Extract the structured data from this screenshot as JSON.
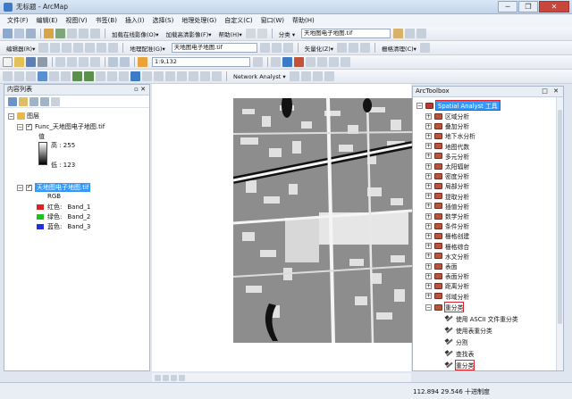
{
  "window": {
    "title": "无标题 - ArcMap",
    "controls": [
      "─",
      "❐",
      "✕"
    ]
  },
  "menu": [
    "文件(F)",
    "编辑(E)",
    "视图(V)",
    "书签(B)",
    "插入(I)",
    "选择(S)",
    "地理处理(G)",
    "自定义(C)",
    "窗口(W)",
    "帮助(H)"
  ],
  "toolbar1": {
    "basemap_online": "加载在线影像(O)▾",
    "basemap_hd": "加载高清影像(F)▾",
    "help": "帮助(H)▾",
    "classify_label": "分类 ▾",
    "classify_layer": "天地图电子地图.tif"
  },
  "toolbar2": {
    "editor": "编辑器(R)▾",
    "georef": "地理配准(G)▾",
    "georef_layer": "天地图电子地图.tif",
    "vectorize": "矢量化(Z)▾",
    "raster_clean": "栅格清理(C)▾"
  },
  "toolbar3": {
    "scale": "1:9,132",
    "network": "Network Analyst ▾"
  },
  "toc": {
    "title": "内容列表",
    "pin": "▫ ✕",
    "group": "图层",
    "layer1": {
      "name": "Func_天地图电子地图.tif",
      "value_label": "值",
      "high": "高 : 255",
      "low": "低 : 123"
    },
    "layer2": {
      "name": "天地图电子地图.tif",
      "rgb": "RGB",
      "bands": [
        {
          "label": "红色:",
          "band": "Band_1",
          "color": "#e02020"
        },
        {
          "label": "绿色:",
          "band": "Band_2",
          "color": "#20c020"
        },
        {
          "label": "蓝色:",
          "band": "Band_3",
          "color": "#2030e0"
        }
      ]
    }
  },
  "toolbox": {
    "title": "ArcToolbox",
    "controls": "□ ✕",
    "root": "Spatial Analyst 工具",
    "toolsets": [
      "区域分析",
      "叠加分析",
      "地下水分析",
      "地图代数",
      "多元分析",
      "太阳辐射",
      "密度分析",
      "局部分析",
      "提取分析",
      "插值分析",
      "数学分析",
      "条件分析",
      "栅格创建",
      "栅格综合",
      "水文分析",
      "表面",
      "表面分析",
      "距离分析",
      "邻域分析"
    ],
    "reclass": {
      "name": "重分类",
      "tools": [
        "使用 ASCII 文件重分类",
        "使用表重分类",
        "分割",
        "查找表",
        "重分类"
      ]
    }
  },
  "status": {
    "coords": "112.894  29.546 十进制度"
  }
}
